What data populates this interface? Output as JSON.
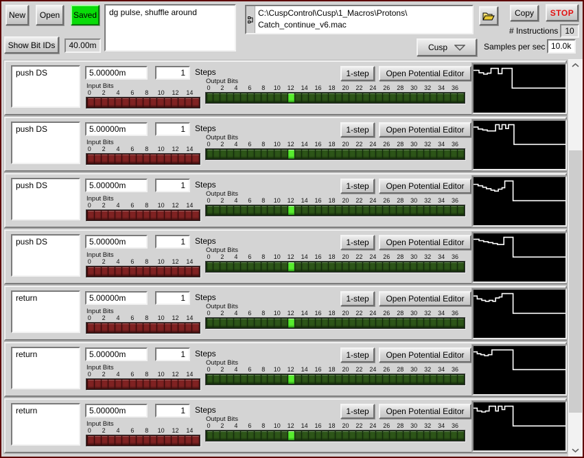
{
  "toolbar": {
    "new_label": "New",
    "open_label": "Open",
    "saved_label": "Saved",
    "description": "dg pulse, shuffle around",
    "path_line1": "C:\\CuspControl\\Cusp\\1_Macros\\Protons\\",
    "path_line2": "Catch_continue_v6.mac",
    "folder_icon": "open-folder-icon",
    "copy_label": "Copy",
    "stop_label": "STOP",
    "instructions_label": "# Instructions",
    "instructions_value": "10",
    "show_bit_ids_label": "Show Bit IDs",
    "duration_value": "40.00m",
    "mode_selected": "Cusp",
    "samples_label": "Samples per sec",
    "samples_value": "10.0k"
  },
  "row_labels": {
    "steps": "Steps",
    "input_bits": "Input Bits",
    "output_bits": "Output Bits",
    "one_step": "1-step",
    "open_editor": "Open Potential Editor"
  },
  "input_led_count": 16,
  "output_led_count": 38,
  "input_ticks": [
    0,
    2,
    4,
    6,
    8,
    10,
    12,
    14
  ],
  "output_ticks": [
    0,
    2,
    4,
    6,
    8,
    10,
    12,
    14,
    16,
    18,
    20,
    22,
    24,
    26,
    28,
    30,
    32,
    34,
    36
  ],
  "colors": {
    "saved_green": "#09dc09",
    "stop_red": "#e21111",
    "led_off_red": "#802222",
    "led_off_green": "#2d5518",
    "led_on_green": "#58ee2e",
    "panel_gray": "#d4d4d4",
    "window_border_maroon": "#5e0000",
    "waveform_white": "#ffffff",
    "waveform_bg": "#000000"
  },
  "rows": [
    {
      "name": "push DS",
      "time": "5.00000m",
      "steps": "1",
      "output_on": 12,
      "waveform": [
        0,
        12,
        6,
        12,
        6,
        17,
        11,
        17,
        11,
        20,
        15,
        20,
        15,
        18,
        19,
        18,
        19,
        8,
        27,
        8,
        27,
        19,
        31,
        19,
        31,
        8,
        42,
        8,
        42,
        49,
        100,
        49
      ]
    },
    {
      "name": "push DS",
      "time": "5.00000m",
      "steps": "1",
      "output_on": 12,
      "waveform": [
        0,
        13,
        5,
        13,
        5,
        17,
        10,
        17,
        10,
        19,
        15,
        19,
        15,
        21,
        24,
        21,
        24,
        8,
        28,
        8,
        28,
        17,
        31,
        17,
        31,
        8,
        35,
        8,
        35,
        16,
        38,
        16,
        38,
        8,
        44,
        8,
        44,
        49,
        100,
        49
      ]
    },
    {
      "name": "push DS",
      "time": "5.00000m",
      "steps": "1",
      "output_on": 12,
      "waveform": [
        0,
        15,
        5,
        15,
        5,
        18,
        10,
        18,
        10,
        21,
        14,
        21,
        14,
        24,
        19,
        24,
        19,
        27,
        23,
        27,
        23,
        29,
        27,
        29,
        27,
        25,
        31,
        25,
        31,
        22,
        34,
        22,
        34,
        8,
        43,
        8,
        43,
        49,
        100,
        49
      ]
    },
    {
      "name": "push DS",
      "time": "5.00000m",
      "steps": "1",
      "output_on": 12,
      "waveform": [
        0,
        12,
        6,
        12,
        6,
        15,
        11,
        15,
        11,
        17,
        16,
        17,
        16,
        19,
        21,
        19,
        21,
        21,
        26,
        21,
        26,
        23,
        33,
        23,
        33,
        8,
        43,
        8,
        43,
        49,
        100,
        49
      ]
    },
    {
      "name": "return",
      "time": "5.00000m",
      "steps": "1",
      "output_on": 12,
      "waveform": [
        0,
        13,
        4,
        13,
        4,
        19,
        9,
        19,
        9,
        22,
        13,
        22,
        13,
        24,
        17,
        24,
        17,
        22,
        21,
        22,
        21,
        24,
        24,
        24,
        24,
        17,
        28,
        17,
        28,
        15,
        31,
        15,
        31,
        8,
        43,
        8,
        43,
        49,
        100,
        49
      ]
    },
    {
      "name": "return",
      "time": "5.00000m",
      "steps": "1",
      "output_on": 12,
      "waveform": [
        0,
        12,
        4,
        12,
        4,
        16,
        8,
        16,
        8,
        18,
        12,
        18,
        12,
        20,
        16,
        20,
        16,
        18,
        20,
        18,
        20,
        8,
        43,
        8,
        43,
        49,
        100,
        49
      ]
    },
    {
      "name": "return",
      "time": "5.00000m",
      "steps": "1",
      "output_on": 12,
      "waveform": [
        0,
        12,
        4,
        12,
        4,
        18,
        9,
        18,
        9,
        20,
        13,
        20,
        13,
        18,
        17,
        18,
        17,
        8,
        24,
        8,
        24,
        18,
        27,
        18,
        27,
        8,
        31,
        8,
        31,
        15,
        34,
        15,
        34,
        8,
        43,
        8,
        43,
        49,
        100,
        49
      ]
    }
  ]
}
